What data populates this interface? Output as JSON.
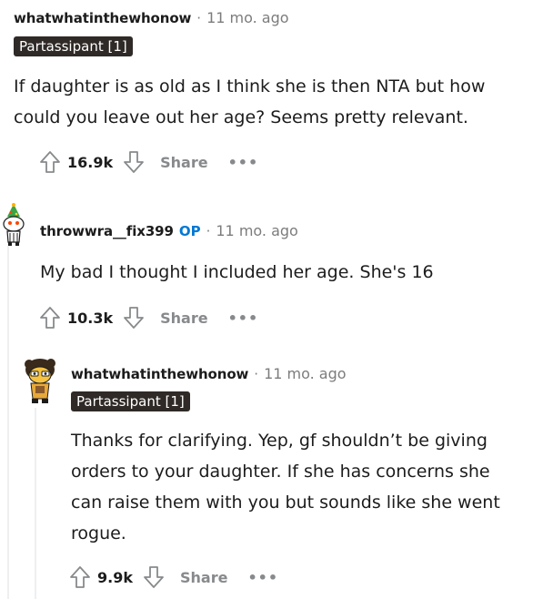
{
  "comments": [
    {
      "username": "whatwhatinthewhonow",
      "separator": "·",
      "time": "11 mo. ago",
      "flair": "Partassipant [1]",
      "body": "If daughter is as old as I think she is then NTA but how could you leave out her age? Seems pretty relevant.",
      "score": "16.9k",
      "share_label": "Share",
      "more_label": "•••"
    },
    {
      "username": "throwwra__fix399",
      "op_label": "OP",
      "separator": "·",
      "time": "11 mo. ago",
      "body": "My bad I thought I included her age. She's 16",
      "score": "10.3k",
      "share_label": "Share",
      "more_label": "•••"
    },
    {
      "username": "whatwhatinthewhonow",
      "separator": "·",
      "time": "11 mo. ago",
      "flair": "Partassipant [1]",
      "body": "Thanks for clarifying. Yep, gf shouldn’t be giving orders to your daughter. If she has concerns she can raise them with you but sounds like she went rogue.",
      "score": "9.9k",
      "share_label": "Share",
      "more_label": "•••"
    }
  ],
  "icons": {
    "upvote": "upvote-arrow-icon",
    "downvote": "downvote-arrow-icon"
  },
  "colors": {
    "op": "#0079d3",
    "flair_bg": "#2f2a27",
    "muted": "#878a8c",
    "thread_line": "#edeff1"
  }
}
